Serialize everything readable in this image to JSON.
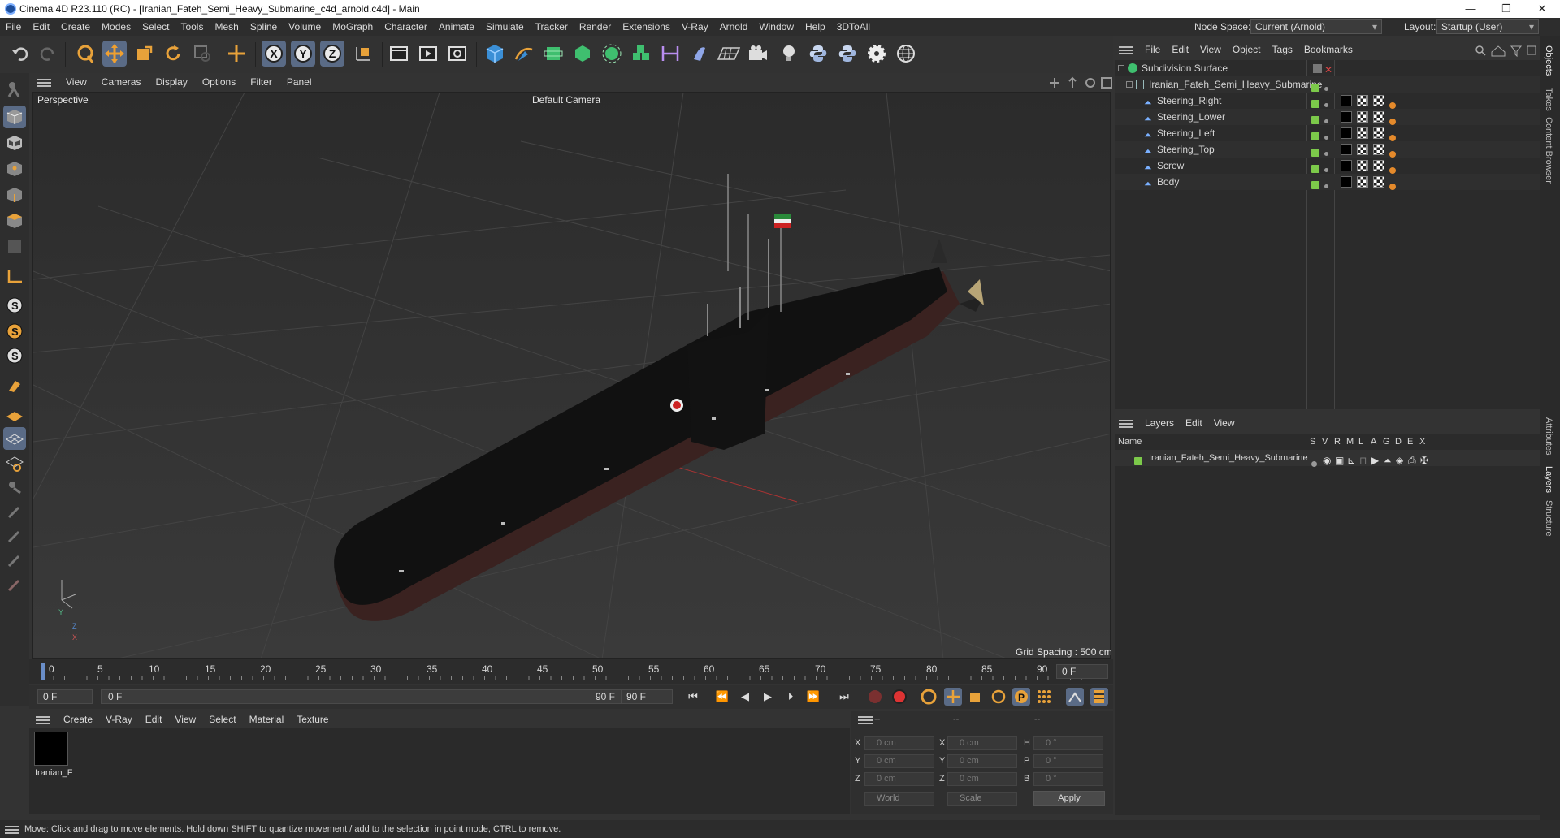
{
  "titlebar": {
    "title": "Cinema 4D R23.110 (RC) - [Iranian_Fateh_Semi_Heavy_Submarine_c4d_arnold.c4d] - Main",
    "minimize": "—",
    "restore": "❐",
    "close": "✕"
  },
  "menubar": {
    "items": [
      "File",
      "Edit",
      "Create",
      "Modes",
      "Select",
      "Tools",
      "Mesh",
      "Spline",
      "Volume",
      "MoGraph",
      "Character",
      "Animate",
      "Simulate",
      "Tracker",
      "Render",
      "Extensions",
      "V-Ray",
      "Arnold",
      "Window",
      "Help",
      "3DToAll"
    ]
  },
  "nodespace": {
    "label": "Node Space:",
    "value": "Current (Arnold)"
  },
  "layout": {
    "label": "Layout:",
    "value": "Startup (User)"
  },
  "viewport": {
    "menu": [
      "Cameras",
      "Display",
      "Options",
      "Filter",
      "Panel"
    ],
    "view_label": "View",
    "projection": "Perspective",
    "camera": "Default Camera",
    "grid_spacing": "Grid Spacing : 500 cm",
    "axis": {
      "y": "Y",
      "z": "Z",
      "x": "X"
    }
  },
  "timeline": {
    "ticks": [
      "0",
      "5",
      "10",
      "15",
      "20",
      "25",
      "30",
      "35",
      "40",
      "45",
      "50",
      "55",
      "60",
      "65",
      "70",
      "75",
      "80",
      "85",
      "90"
    ],
    "frame_right": "0 F"
  },
  "controls": {
    "start": "0 F",
    "range_start": "0 F",
    "range_end": "90 F",
    "end": "90 F"
  },
  "material": {
    "menu": [
      "Create",
      "V-Ray",
      "Edit",
      "View",
      "Select",
      "Material",
      "Texture"
    ],
    "swatch_name": "Iranian_F"
  },
  "coords": {
    "headers": [
      "--",
      "--",
      "--"
    ],
    "rows": [
      {
        "a": "X",
        "av": "0 cm",
        "b": "X",
        "bv": "0 cm",
        "c": "H",
        "cv": "0 °"
      },
      {
        "a": "Y",
        "av": "0 cm",
        "b": "Y",
        "bv": "0 cm",
        "c": "P",
        "cv": "0 °"
      },
      {
        "a": "Z",
        "av": "0 cm",
        "b": "Z",
        "bv": "0 cm",
        "c": "B",
        "cv": "0 °"
      }
    ],
    "world": "World",
    "scale": "Scale",
    "apply": "Apply"
  },
  "status": "Move: Click and drag to move elements. Hold down SHIFT to quantize movement / add to the selection in point mode, CTRL to remove.",
  "objects": {
    "menu": [
      "File",
      "Edit",
      "View",
      "Object",
      "Tags",
      "Bookmarks"
    ],
    "tree": [
      {
        "name": "Subdivision Surface"
      },
      {
        "name": "Iranian_Fateh_Semi_Heavy_Submarine"
      },
      {
        "name": "Steering_Right"
      },
      {
        "name": "Steering_Lower"
      },
      {
        "name": "Steering_Left"
      },
      {
        "name": "Steering_Top"
      },
      {
        "name": "Screw"
      },
      {
        "name": "Body"
      }
    ]
  },
  "layers": {
    "menu": [
      "Layers",
      "Edit",
      "View"
    ],
    "col_name": "Name",
    "cols": [
      "S",
      "V",
      "R",
      "M",
      "L",
      "A",
      "G",
      "D",
      "E",
      "X"
    ],
    "rows": [
      {
        "name": "Iranian_Fateh_Semi_Heavy_Submarine"
      }
    ]
  },
  "sidetabs": [
    "Objects",
    "Takes",
    "Content Browser",
    "Attributes",
    "Layers",
    "Structure"
  ],
  "colors": {
    "accent": "#5a6b86",
    "layer_green": "#7cc94a",
    "tag_orange": "#e58a2b"
  }
}
